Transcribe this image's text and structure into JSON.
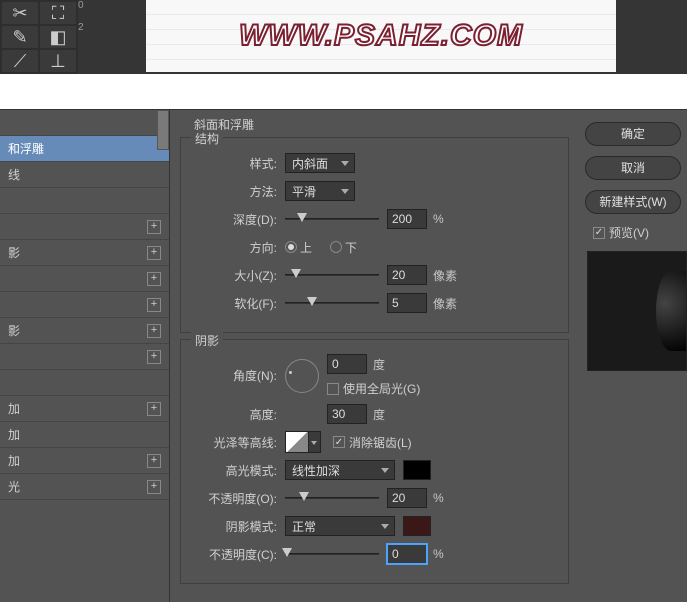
{
  "header": {
    "logo_text": "WWW.PSAHZ.COM"
  },
  "styles_list": {
    "items": [
      {
        "label": "",
        "plus": false
      },
      {
        "label": "和浮雕",
        "plus": false,
        "selected": true
      },
      {
        "label": "线",
        "plus": false
      },
      {
        "label": "",
        "plus": false
      },
      {
        "label": "",
        "plus": true
      },
      {
        "label": "影",
        "plus": true
      },
      {
        "label": "",
        "plus": true
      },
      {
        "label": "",
        "plus": true
      },
      {
        "label": "影",
        "plus": true
      },
      {
        "label": "",
        "plus": true
      },
      {
        "label": "",
        "plus": false
      },
      {
        "label": "加",
        "plus": true
      },
      {
        "label": "加",
        "plus": false
      },
      {
        "label": "加",
        "plus": true
      },
      {
        "label": "光",
        "plus": true
      }
    ]
  },
  "panel": {
    "title": "斜面和浮雕",
    "structure": {
      "group_label": "结构",
      "style_label": "样式:",
      "style_value": "内斜面",
      "method_label": "方法:",
      "method_value": "平滑",
      "depth_label": "深度(D):",
      "depth_value": "200",
      "depth_unit": "%",
      "direction_label": "方向:",
      "dir_up": "上",
      "dir_down": "下",
      "size_label": "大小(Z):",
      "size_value": "20",
      "size_unit": "像素",
      "soften_label": "软化(F):",
      "soften_value": "5",
      "soften_unit": "像素"
    },
    "shadow": {
      "group_label": "阴影",
      "angle_label": "角度(N):",
      "angle_value": "0",
      "angle_unit": "度",
      "global_light": "使用全局光(G)",
      "altitude_label": "高度:",
      "altitude_value": "30",
      "altitude_unit": "度",
      "gloss_label": "光泽等高线:",
      "antialias": "消除锯齿(L)",
      "highlight_mode_label": "高光模式:",
      "highlight_mode_value": "线性加深",
      "highlight_color": "#000000",
      "highlight_opacity_label": "不透明度(O):",
      "highlight_opacity_value": "20",
      "highlight_opacity_unit": "%",
      "shadow_mode_label": "阴影模式:",
      "shadow_mode_value": "正常",
      "shadow_color": "#3a1818",
      "shadow_opacity_label": "不透明度(C):",
      "shadow_opacity_value": "0",
      "shadow_opacity_unit": "%"
    }
  },
  "buttons": {
    "ok": "确定",
    "cancel": "取消",
    "new_style": "新建样式(W)",
    "preview": "预览(V)"
  }
}
